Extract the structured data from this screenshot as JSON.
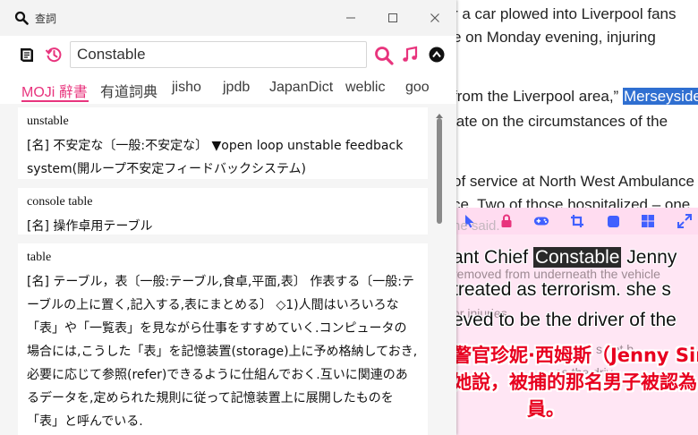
{
  "window": {
    "title": "查詞"
  },
  "search": {
    "query": "Constable",
    "placeholder": ""
  },
  "tabs": [
    {
      "label": "MOJi 辭書",
      "active": true
    },
    {
      "label": "有道詞典",
      "active": false
    },
    {
      "label": "jisho",
      "active": false
    },
    {
      "label": "jpdb",
      "active": false
    },
    {
      "label": "JapanDict",
      "active": false
    },
    {
      "label": "weblic",
      "active": false
    },
    {
      "label": "goo",
      "active": false
    }
  ],
  "entries": [
    {
      "headword": "unstable",
      "definition": "[名] 不安定な〔一般:不安定な〕 ▼open loop unstable feedback system(開ループ不安定フィードバックシステム)"
    },
    {
      "headword": "console table",
      "definition": "[名] 操作卓用テーブル"
    },
    {
      "headword": "table",
      "definition": "[名] テーブル，表〔一般:テーブル,食卓,平面,表〕 作表する〔一般:テーブルの上に置く,記入する,表にまとめる〕 ◇1)人間はいろいろな「表」や「一覧表」を見ながら仕事をすすめていく.コンピュータの場合には,こうした「表」を記憶装置(storage)上に予め格納しておき,必要に応じて参照(refer)できるように仕組んでおく.互いに関連のあるデータを,定められた規則に従って記憶装置上に展開したものを「表」と呼んでいる."
    }
  ],
  "article": {
    "lines": [
      "r a car plowed into Liverpool fans",
      "e on Monday evening, injuring",
      "from the Liverpool area,”",
      "late on the circumstances of the",
      "of service at North West Ambulance",
      "ce. Two of those hospitalized – one"
    ],
    "highlighted_word": "Merseyside",
    "faint_text": "he said."
  },
  "subtitles": {
    "background_lines": [
      "removed from underneath the vehicle",
      "or injuries.",
      "s not b",
      "as the driv"
    ],
    "en_line_1_prefix": "ant Chief ",
    "en_line_1_highlight": "Constable",
    "en_line_1_suffix": " Jenny",
    "en_line_2": "treated as terrorism. she s",
    "en_line_3": "eved to be the driver of the",
    "zh_line_1": "警官珍妮·西姆斯（Jenny Sim",
    "zh_line_2": "她說，被捕的那名男子被認為",
    "zh_line_3": "員。"
  },
  "colors": {
    "accent": "#e8347d",
    "highlight": "#2f6fd1",
    "subtitle_zh": "#e8001f",
    "overlay_bar": "#ffdcf0",
    "overlay_icons": "#4060ff"
  }
}
